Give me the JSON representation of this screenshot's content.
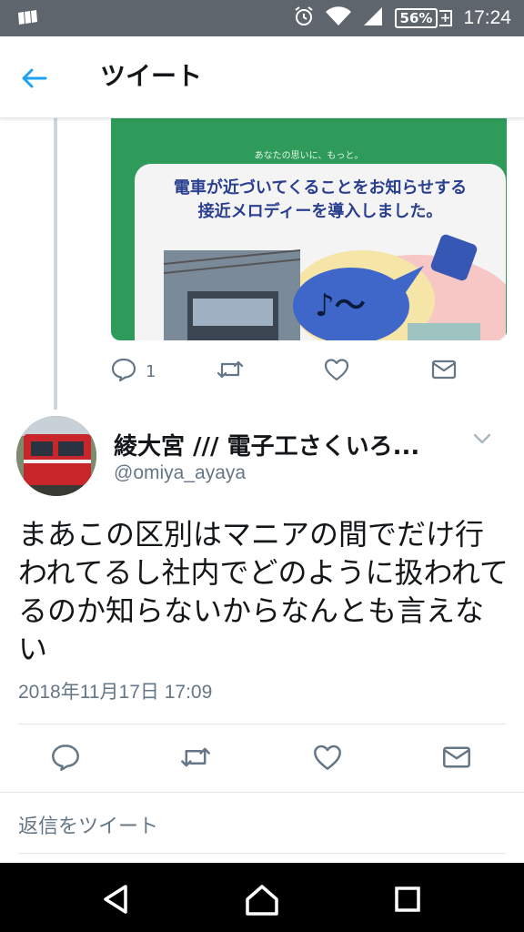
{
  "status_bar": {
    "battery": "56%",
    "battery_charging": "+",
    "time": "17:24"
  },
  "header": {
    "title": "ツイート"
  },
  "parent_tweet": {
    "media_caption": "あなたの思いに、もっと。",
    "media_heading_line1": "電車が近づいてくることをお知らせする",
    "media_heading_line2": "接近メロディーを導入しました。",
    "media_note": "♪～",
    "reply_count": "1"
  },
  "tweet": {
    "author_name": "綾大宮 /// 電子工さくいろ...",
    "author_handle": "@omiya_ayaya",
    "text": "まあこの区別はマニアの間でだけ行われてるし社内でどのように扱われてるのか知らないからなんとも言えない",
    "timestamp": "2018年11月17日 17:09"
  },
  "reply": {
    "placeholder": "返信をツイート"
  },
  "colors": {
    "accent": "#1da1f2",
    "status_bar": "#5e656c",
    "icon_gray": "#657786",
    "divider": "#e1e8ed",
    "media_green": "#2e9b5a"
  }
}
